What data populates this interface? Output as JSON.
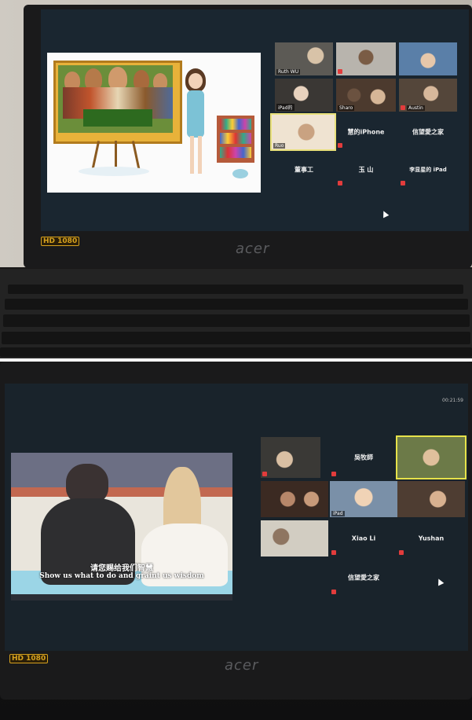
{
  "top": {
    "badge_hd": "HD",
    "badge_res": "1080",
    "brand": "acer",
    "share": {
      "slide_caption_line1": "",
      "slide_caption_line2": "",
      "logo_text": ""
    },
    "tiles": [
      {
        "name": "Ruth WU",
        "kind": "video"
      },
      {
        "name": "",
        "kind": "video"
      },
      {
        "name": "",
        "kind": "video"
      },
      {
        "name": "iPad的",
        "kind": "video"
      },
      {
        "name": "Sharo",
        "kind": "video"
      },
      {
        "name": "Austin",
        "kind": "video"
      },
      {
        "name": "Ruo",
        "kind": "video"
      },
      {
        "name": "慧的iPhone",
        "kind": "name"
      },
      {
        "name": "信望愛之家",
        "kind": "name"
      },
      {
        "name": "董事工",
        "kind": "name"
      },
      {
        "name": "玉 山",
        "kind": "name"
      },
      {
        "name": "李显星的 iPad",
        "kind": "name"
      }
    ]
  },
  "bottom": {
    "badge_hd": "HD",
    "badge_res": "1080",
    "brand": "acer",
    "timer": "00:21:59",
    "subtitle_cn": "请您赐给我们智慧",
    "subtitle_en": "Show us what to do and graint us wisdom",
    "tiles": [
      {
        "name": "",
        "kind": "video"
      },
      {
        "name": "吳牧師",
        "kind": "name"
      },
      {
        "name": "",
        "kind": "video"
      },
      {
        "name": "",
        "kind": "video"
      },
      {
        "name": "iPad",
        "kind": "video"
      },
      {
        "name": "",
        "kind": "video"
      },
      {
        "name": "",
        "kind": "video"
      },
      {
        "name": "Xiao Li",
        "kind": "name"
      },
      {
        "name": "Yushan",
        "kind": "name"
      },
      {
        "name": "信望愛之家",
        "kind": "name"
      }
    ]
  }
}
